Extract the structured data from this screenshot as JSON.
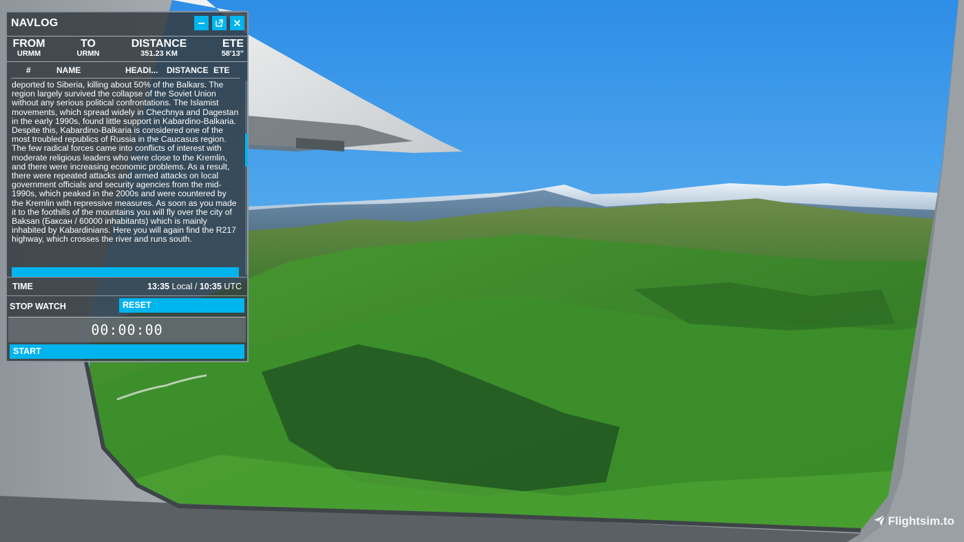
{
  "navlog": {
    "title": "NAVLOG",
    "controls": {
      "minimize_icon": "minus-icon",
      "popout_icon": "external-window-icon",
      "close_icon": "close-icon"
    },
    "route": {
      "from_label": "FROM",
      "from_value": "URMM",
      "to_label": "TO",
      "to_value": "URMN",
      "distance_label": "DISTANCE",
      "distance_value": "351.23 KM",
      "ete_label": "ETE",
      "ete_value": "58'13\""
    },
    "columns": [
      "#",
      "NAME",
      "HEADI...",
      "DISTANCE",
      "ETE"
    ],
    "description": "deported to Siberia, killing about 50% of the Balkars. The region largely survived the collapse of the Soviet Union without any serious political confrontations. The Islamist movements, which spread widely in Chechnya and Dagestan in the early 1990s, found little support in Kabardino-Balkaria. Despite this, Kabardino-Balkaria is considered one of the most troubled republics of Russia in the Caucasus region. The few radical forces came into conflicts of interest with moderate religious leaders who were close to the Kremlin, and there were increasing economic problems. As a result, there were repeated attacks and armed attacks on local government officials and security agencies from the mid-1990s, which peaked in the 2000s and were countered by the Kremlin with repressive measures. As soon as you made it to the foothills of the mountains you will fly over the city of Baksan (Баксан / 60000 inhabitants) which is mainly inhabited by Kabardinians. Here you will again find the R217 highway, which crosses the river and runs south.",
    "time": {
      "label": "TIME",
      "local_time": "13:35",
      "local_label": "Local /",
      "utc_time": "10:35",
      "utc_label": "UTC"
    },
    "stopwatch": {
      "label": "STOP WATCH",
      "reset_label": "RESET",
      "display": "00:00:00",
      "start_label": "START"
    }
  },
  "watermark": {
    "text": "Flightsim.to",
    "icon": "paper-plane-icon"
  },
  "colors": {
    "accent": "#00b4ee",
    "panel_bg": "#343c42",
    "sky": "#4aa6ef",
    "grass": "#3b8a2c"
  }
}
